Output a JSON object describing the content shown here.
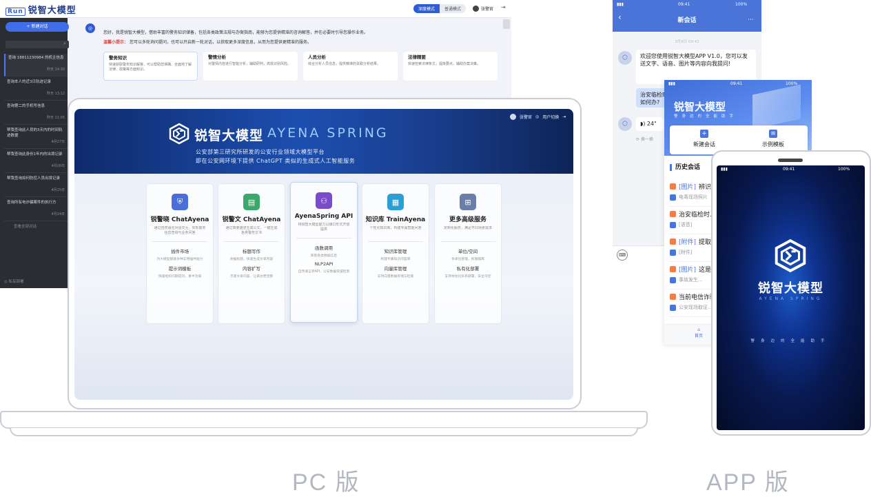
{
  "bg_app": {
    "logo_badge": "Run",
    "logo_text": "锐智大模型",
    "mode_tabs": [
      "深度模式",
      "普通模式"
    ],
    "user_name": "张警官",
    "new_chat": "+ 新建对话",
    "sessions": [
      {
        "title": "查询 18811230984 的机主信息",
        "date": "昨天 14:30"
      },
      {
        "title": "查询本人的近3日轨迹记录",
        "date": "昨天 13:12"
      },
      {
        "title": "查询第二的手机号信息",
        "date": "昨天 11:05"
      },
      {
        "title": "帮我查询此人员的3天内的时间轨迹数据",
        "date": "4月27日"
      },
      {
        "title": "帮我查询此身份1年内的出境记录",
        "date": "4月26日"
      },
      {
        "title": "帮我查询如何防控人员出境记录",
        "date": "4月25日"
      },
      {
        "title": "查询所有电诈骗案件的执行方",
        "date": "4月24日"
      }
    ],
    "more_sessions": "查看全部对话",
    "footer": "◎ 私有部署",
    "welcome_line": "您好，我是锐智大模型，借助丰富的警务知识储备，包括各类政策法规与办案指南，能够为您提供精准的咨询解答，并在必要时引导您操作业务。",
    "tip_label": "温馨小提示：",
    "tip_text": "您可以多轮询问提问，也可以开启新一轮对话，以获取更多深度信息，从而为您提供更精准的服务。",
    "cards": [
      {
        "title": "警务知识",
        "desc": "快速获取警务知识解答，可以帮助您准确、全面地了解法律、政策等方面知识。"
      },
      {
        "title": "警情分析",
        "desc": "对警情内容进行智能分析，辅助研判，高效识别风险。"
      },
      {
        "title": "人员分析",
        "desc": "综合分析人员信息，提供精准的关联分析结果。"
      },
      {
        "title": "法律精要",
        "desc": "快速检索法律条文，提炼要点，辅助办案决策。"
      }
    ]
  },
  "laptop": {
    "user_name": "张警官",
    "switch_label": "用户切换",
    "title_cn": "锐智大模型",
    "title_en": "AYENA  SPRING",
    "subtitle_1": "公安部第三研究所研发的公安行业领域大模型平台",
    "subtitle_2": "即在公安网环境下提供 ChatGPT 类似的生成式人工智能服务",
    "products": [
      {
        "icon": "shield-icon",
        "color": "#4a6fd6",
        "name": "锐警晓 ChatAyena",
        "desc": "通过自然语言对话交互，实现警务信息查询与业务问答",
        "features": [
          {
            "name": "插件市场",
            "desc": "为大模型赋能多种实用插件能力"
          },
          {
            "name": "提示词模板",
            "desc": "快速组织问题提问，事半功倍"
          }
        ]
      },
      {
        "icon": "book-icon",
        "color": "#3aa86a",
        "name": "锐警文 ChatAyena",
        "desc": "通过简要描述生成公文，一键生成各类警务文书",
        "features": [
          {
            "name": "标题写作",
            "desc": "依据标题，快速生成文章内容"
          },
          {
            "name": "内容扩写",
            "desc": "丰富文章内容，让表达更完整"
          }
        ]
      },
      {
        "icon": "network-icon",
        "color": "#7b4cc9",
        "name": "AyenaSpring API",
        "desc": "将锐智大模型能力以接口形式开放提供",
        "features": [
          {
            "name": "函数调用",
            "desc": "获取各类数据信息"
          },
          {
            "name": "NLP2API",
            "desc": "自然语言转API，公安数据快速检索"
          }
        ]
      },
      {
        "icon": "database-icon",
        "color": "#2a9fd6",
        "name": "知识库 TrainAyena",
        "desc": "个性化知识库，构建专属智能问答",
        "features": [
          {
            "name": "知识库管理",
            "desc": "构建专属知识问答库"
          },
          {
            "name": "向量库管理",
            "desc": "支持向量数据存储与检索"
          }
        ]
      },
      {
        "icon": "grid-icon",
        "color": "#6a7fa8",
        "name": "更多高级服务",
        "desc": "定制化服务，满足不同场景需求",
        "features": [
          {
            "name": "单位/空间",
            "desc": "多单位管理，权限隔离"
          },
          {
            "name": "私有化部署",
            "desc": "支持本地化私有部署，安全可控"
          }
        ]
      }
    ]
  },
  "phone_chat": {
    "status_time": "09:41",
    "status_battery": "100%",
    "title": "新会话",
    "date_sep": "3月8日 09:41",
    "bot_msg": "欢迎您使用锐智大模型APP V1.0，您可以发送文字、语音、图片等内容向我提问!",
    "user_msg": "治安临检时，如何办?",
    "voice_len": "24\"",
    "refresh_label": "换一换"
  },
  "phone_home": {
    "status_time": "09:41",
    "status_battery": "100%",
    "title": "锐智大模型",
    "subtitle": "警身边的全能助手",
    "new_chat": "新建会话",
    "example": "示例模板",
    "history_title": "历史会话",
    "history": [
      {
        "tag": "[图片]",
        "title": "辨识图片中...",
        "sub": "电毒现场照片"
      },
      {
        "title": "治安临检时...",
        "sub": "[语音]"
      },
      {
        "tag": "[附件]",
        "title": "提取文档...",
        "sub": "[附件]"
      },
      {
        "tag": "[图片]",
        "title": "这是...",
        "sub": "事故发生..."
      },
      {
        "title": "当前电信诈骗...",
        "sub": "公安现场取证..."
      }
    ],
    "tab_home": "首页"
  },
  "phone_splash": {
    "status_time": "09:41",
    "status_battery": "100%",
    "title": "锐智大模型",
    "title_en": "AYENA SPRING",
    "slogan": "警身边的全能助手"
  },
  "captions": {
    "pc": "PC 版",
    "app": "APP 版"
  }
}
